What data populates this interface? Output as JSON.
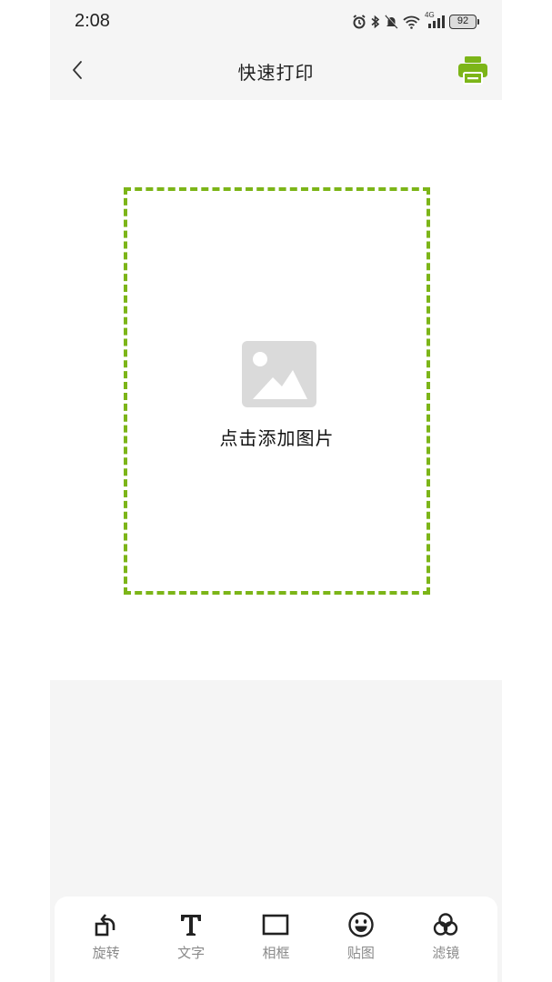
{
  "status_bar": {
    "time": "2:08",
    "network": "4G",
    "battery": "92"
  },
  "header": {
    "title": "快速打印",
    "back_icon": "chevron-left-icon",
    "print_icon": "printer-icon",
    "accent_color": "#7cb518"
  },
  "canvas": {
    "add_image_label": "点击添加图片",
    "placeholder_icon": "image-placeholder-icon",
    "border_color": "#7cb518"
  },
  "toolbar": {
    "items": [
      {
        "label": "旋转",
        "icon": "rotate-icon"
      },
      {
        "label": "文字",
        "icon": "text-icon"
      },
      {
        "label": "相框",
        "icon": "frame-icon"
      },
      {
        "label": "贴图",
        "icon": "sticker-icon"
      },
      {
        "label": "滤镜",
        "icon": "filter-icon"
      }
    ]
  }
}
